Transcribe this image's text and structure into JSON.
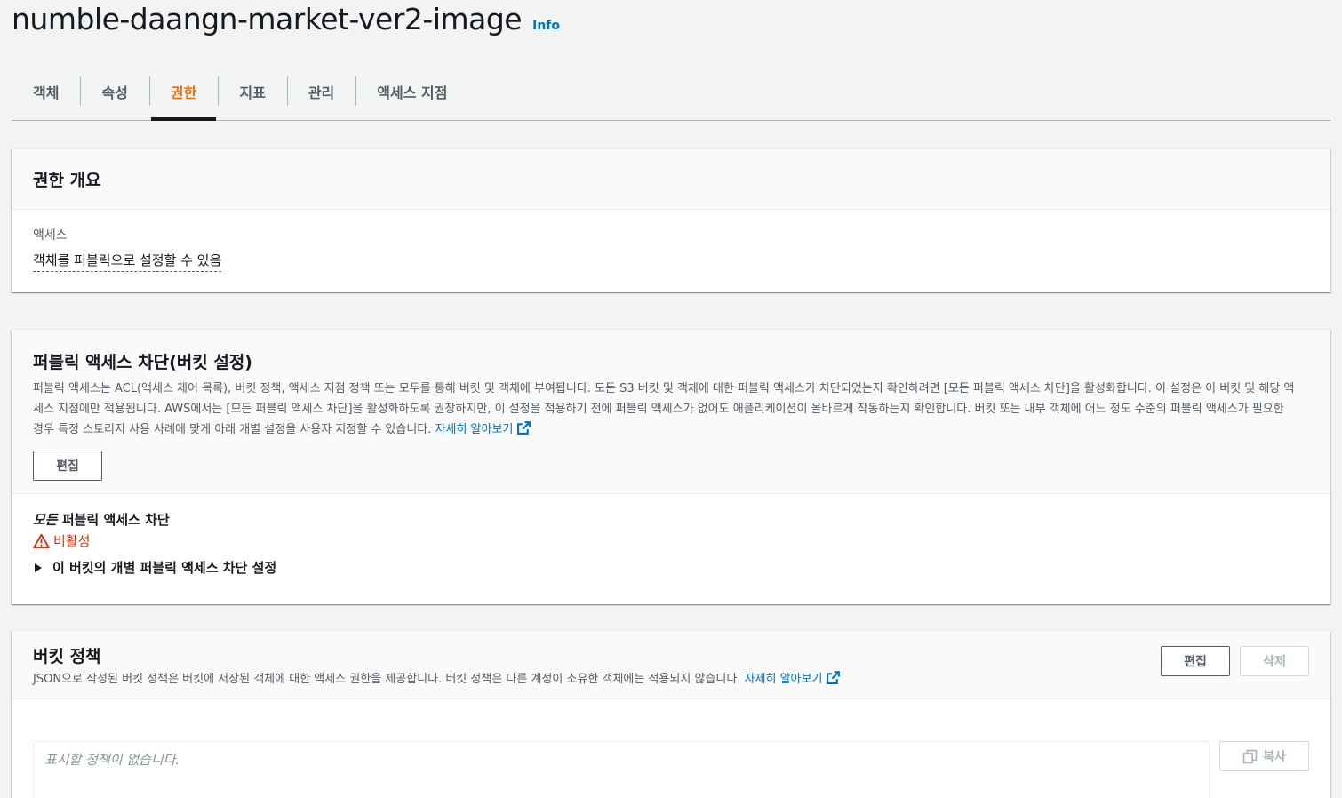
{
  "header": {
    "title": "numble-daangn-market-ver2-image",
    "info_label": "Info"
  },
  "tabs": [
    {
      "label": "객체",
      "active": false
    },
    {
      "label": "속성",
      "active": false
    },
    {
      "label": "권한",
      "active": true
    },
    {
      "label": "지표",
      "active": false
    },
    {
      "label": "관리",
      "active": false
    },
    {
      "label": "액세스 지점",
      "active": false
    }
  ],
  "permissions_overview": {
    "title": "권한 개요",
    "access_label": "액세스",
    "access_value": "객체를 퍼블릭으로 설정할 수 있음"
  },
  "block_public_access": {
    "title": "퍼블릭 액세스 차단(버킷 설정)",
    "description": "퍼블릭 액세스는 ACL(액세스 제어 목록), 버킷 정책, 액세스 지점 정책 또는 모두를 통해 버킷 및 객체에 부여됩니다. 모든 S3 버킷 및 객체에 대한 퍼블릭 액세스가 차단되었는지 확인하려면 [모든 퍼블릭 액세스 차단]을 활성화합니다. 이 설정은 이 버킷 및 해당 액세스 지점에만 적용됩니다. AWS에서는 [모든 퍼블릭 액세스 차단]을 활성화하도록 권장하지만, 이 설정을 적용하기 전에 퍼블릭 액세스가 없어도 애플리케이션이 올바르게 작동하는지 확인합니다. 버킷 또는 내부 객체에 어느 정도 수준의 퍼블릭 액세스가 필요한 경우 특정 스토리지 사용 사례에 맞게 아래 개별 설정을 사용자 지정할 수 있습니다.",
    "learn_more": "자세히 알아보기",
    "edit_label": "편집",
    "setting_title_italic": "모든",
    "setting_title_rest": " 퍼블릭 액세스 차단",
    "status": "비활성",
    "status_color": "#d13212",
    "expand_label": "이 버킷의 개별 퍼블릭 액세스 차단 설정"
  },
  "bucket_policy": {
    "title": "버킷 정책",
    "description": "JSON으로 작성된 버킷 정책은 버킷에 저장된 객체에 대한 액세스 권한을 제공합니다. 버킷 정책은 다른 계정이 소유한 객체에는 적용되지 않습니다.",
    "learn_more": "자세히 알아보기",
    "edit_label": "편집",
    "delete_label": "삭제",
    "editor_placeholder": "표시할 정책이 없습니다.",
    "copy_label": "복사"
  },
  "colors": {
    "accent_tab": "#ec7211",
    "link": "#0073bb",
    "warning": "#d13212"
  }
}
